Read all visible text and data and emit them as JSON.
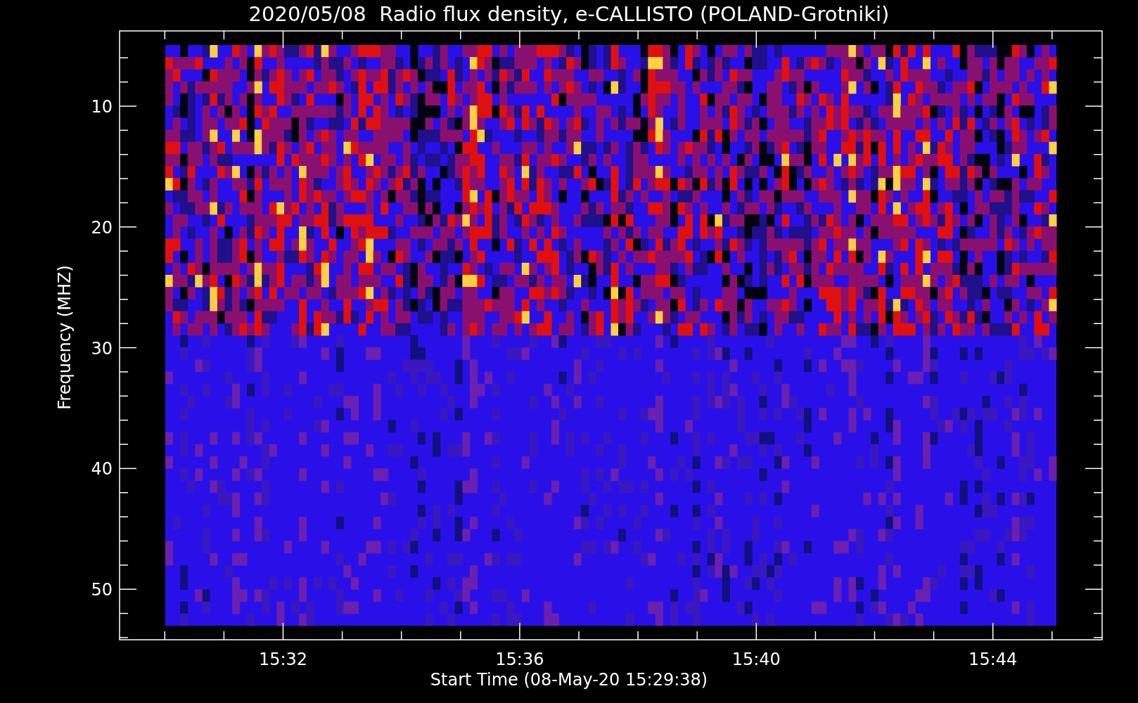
{
  "title": "2020/05/08  Radio flux density, e-CALLISTO (POLAND-Grotniki)",
  "y_axis": {
    "label": "Frequency (MHZ)",
    "ticks": [
      "10",
      "20",
      "30",
      "40",
      "50"
    ]
  },
  "x_axis": {
    "label": "Start Time (08-May-20 15:29:38)",
    "ticks": [
      "15:32",
      "15:36",
      "15:40",
      "15:44"
    ]
  }
}
